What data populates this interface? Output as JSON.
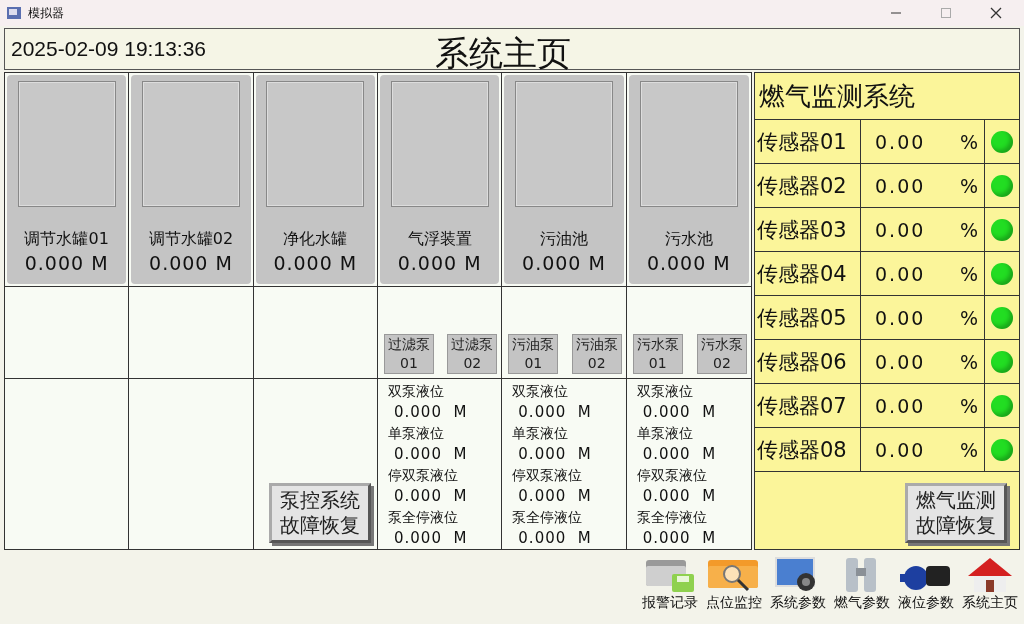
{
  "window": {
    "title": "模拟器"
  },
  "header": {
    "datetime": "2025-02-09 19:13:36",
    "title": "系统主页"
  },
  "tanks": [
    {
      "name": "调节水罐01",
      "value": "0.000",
      "unit": "M"
    },
    {
      "name": "调节水罐02",
      "value": "0.000",
      "unit": "M"
    },
    {
      "name": "净化水罐",
      "value": "0.000",
      "unit": "M"
    },
    {
      "name": "气浮装置",
      "value": "0.000",
      "unit": "M"
    },
    {
      "name": "污油池",
      "value": "0.000",
      "unit": "M"
    },
    {
      "name": "污水池",
      "value": "0.000",
      "unit": "M"
    }
  ],
  "pump_groups": [
    {
      "pumps": [
        {
          "lines": [
            "过滤泵",
            "01"
          ]
        },
        {
          "lines": [
            "过滤泵",
            "02"
          ]
        }
      ],
      "levels": [
        {
          "label": "双泵液位",
          "value": "0.000",
          "unit": "M"
        },
        {
          "label": "单泵液位",
          "value": "0.000",
          "unit": "M"
        },
        {
          "label": "停双泵液位",
          "value": "0.000",
          "unit": "M"
        },
        {
          "label": "泵全停液位",
          "value": "0.000",
          "unit": "M"
        }
      ]
    },
    {
      "pumps": [
        {
          "lines": [
            "污油泵",
            "01"
          ]
        },
        {
          "lines": [
            "污油泵",
            "02"
          ]
        }
      ],
      "levels": [
        {
          "label": "双泵液位",
          "value": "0.000",
          "unit": "M"
        },
        {
          "label": "单泵液位",
          "value": "0.000",
          "unit": "M"
        },
        {
          "label": "停双泵液位",
          "value": "0.000",
          "unit": "M"
        },
        {
          "label": "泵全停液位",
          "value": "0.000",
          "unit": "M"
        }
      ]
    },
    {
      "pumps": [
        {
          "lines": [
            "污水泵",
            "01"
          ]
        },
        {
          "lines": [
            "污水泵",
            "02"
          ]
        }
      ],
      "levels": [
        {
          "label": "双泵液位",
          "value": "0.000",
          "unit": "M"
        },
        {
          "label": "单泵液位",
          "value": "0.000",
          "unit": "M"
        },
        {
          "label": "停双泵液位",
          "value": "0.000",
          "unit": "M"
        },
        {
          "label": "泵全停液位",
          "value": "0.000",
          "unit": "M"
        }
      ]
    }
  ],
  "pump_reset_button": {
    "lines": [
      "泵控系统",
      "故障恢复"
    ]
  },
  "gas_panel": {
    "title": "燃气监测系统",
    "sensors": [
      {
        "name": "传感器01",
        "value": "0.00",
        "unit": "%",
        "color": "#22dd22"
      },
      {
        "name": "传感器02",
        "value": "0.00",
        "unit": "%",
        "color": "#22dd22"
      },
      {
        "name": "传感器03",
        "value": "0.00",
        "unit": "%",
        "color": "#22dd22"
      },
      {
        "name": "传感器04",
        "value": "0.00",
        "unit": "%",
        "color": "#22dd22"
      },
      {
        "name": "传感器05",
        "value": "0.00",
        "unit": "%",
        "color": "#22dd22"
      },
      {
        "name": "传感器06",
        "value": "0.00",
        "unit": "%",
        "color": "#22dd22"
      },
      {
        "name": "传感器07",
        "value": "0.00",
        "unit": "%",
        "color": "#22dd22"
      },
      {
        "name": "传感器08",
        "value": "0.00",
        "unit": "%",
        "color": "#22dd22"
      }
    ],
    "reset_button": {
      "lines": [
        "燃气监测",
        "故障恢复"
      ]
    }
  },
  "nav": [
    {
      "kind": "records",
      "label": "报警记录"
    },
    {
      "kind": "monitor",
      "label": "点位监控"
    },
    {
      "kind": "settings",
      "label": "系统参数"
    },
    {
      "kind": "gas",
      "label": "燃气参数"
    },
    {
      "kind": "pump",
      "label": "液位参数"
    },
    {
      "kind": "home",
      "label": "系统主页"
    }
  ]
}
